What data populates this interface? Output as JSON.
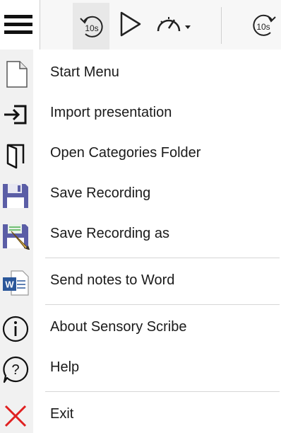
{
  "toolbar": {
    "menu_button_icon": "hamburger-menu-icon",
    "rewind_icon": "rewind-10s-icon",
    "rewind_label": "10s",
    "play_icon": "play-icon",
    "speed_icon": "speedometer-icon",
    "speed_dropdown_icon": "caret-down-icon",
    "forward_icon": "forward-10s-icon",
    "forward_label": "10s"
  },
  "menu": {
    "items": [
      {
        "label": "Start Menu",
        "icon": "document-icon"
      },
      {
        "label": "Import presentation",
        "icon": "import-icon"
      },
      {
        "label": "Open Categories Folder",
        "icon": "folder-icon"
      },
      {
        "label": "Save Recording",
        "icon": "floppy-disk-icon"
      },
      {
        "label": "Save Recording as",
        "icon": "floppy-disk-pencil-icon"
      },
      {
        "label": "Send notes to Word",
        "icon": "word-icon"
      },
      {
        "label": "About Sensory Scribe",
        "icon": "info-icon"
      },
      {
        "label": "Help",
        "icon": "help-icon"
      },
      {
        "label": "Exit",
        "icon": "close-icon"
      }
    ]
  },
  "colors": {
    "floppy": "#5b5ea6",
    "word_blue": "#2b579a",
    "exit_red": "#e02020"
  }
}
